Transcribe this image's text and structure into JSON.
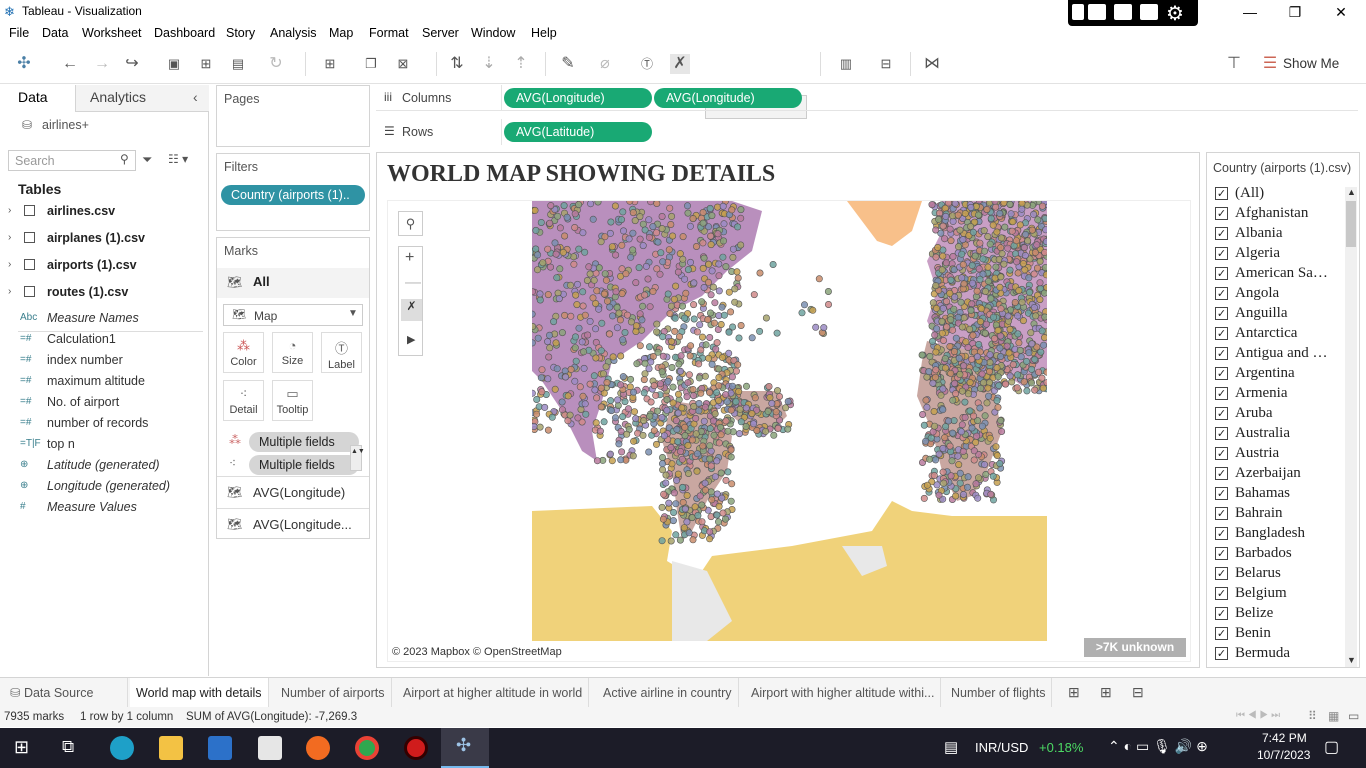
{
  "window": {
    "title": "Tableau - Visualization",
    "min": "—",
    "max": "❐",
    "close": "✕"
  },
  "menu": [
    "File",
    "Data",
    "Worksheet",
    "Dashboard",
    "Story",
    "Analysis",
    "Map",
    "Format",
    "Server",
    "Window",
    "Help"
  ],
  "toolbar": {
    "show_me": "Show Me"
  },
  "data_pane": {
    "tab_data": "Data",
    "tab_analytics": "Analytics",
    "datasource": "airlines+",
    "search_placeholder": "Search",
    "tables_heading": "Tables",
    "tables": [
      "airlines.csv",
      "airplanes (1).csv",
      "airports (1).csv",
      "routes (1).csv"
    ],
    "fields": [
      {
        "icon": "Abc",
        "label": "Measure Names",
        "italic": true
      },
      {
        "icon": "=#",
        "label": "Calculation1",
        "italic": false
      },
      {
        "icon": "=#",
        "label": "index number",
        "italic": false
      },
      {
        "icon": "=#",
        "label": "maximum altitude",
        "italic": false
      },
      {
        "icon": "=#",
        "label": "No. of airport",
        "italic": false
      },
      {
        "icon": "=#",
        "label": "number of records",
        "italic": false
      },
      {
        "icon": "=T|F",
        "label": "top n",
        "italic": false
      },
      {
        "icon": "⊕",
        "label": "Latitude (generated)",
        "italic": true
      },
      {
        "icon": "⊕",
        "label": "Longitude (generated)",
        "italic": true
      },
      {
        "icon": "#",
        "label": "Measure Values",
        "italic": true
      }
    ]
  },
  "shelves": {
    "pages": "Pages",
    "filters": "Filters",
    "filter_pill": "Country (airports (1)..",
    "marks": "Marks",
    "marks_all": "All",
    "mark_type": "Map",
    "mark_buttons": [
      "Color",
      "Size",
      "Label",
      "Detail",
      "Tooltip"
    ],
    "multi1": "Multiple fields",
    "multi2": "Multiple fields",
    "sub1": "AVG(Longitude)",
    "sub2": "AVG(Longitude..."
  },
  "columns": {
    "label": "Columns",
    "pills": [
      "AVG(Longitude)",
      "AVG(Longitude)"
    ]
  },
  "rows": {
    "label": "Rows",
    "pills": [
      "AVG(Latitude)"
    ]
  },
  "viz": {
    "title": "WORLD MAP SHOWING DETAILS",
    "attribution": "© 2023 Mapbox © OpenStreetMap",
    "unknown_badge": ">7K unknown"
  },
  "filter_panel": {
    "title": "Country (airports (1).csv)",
    "items": [
      "(All)",
      "Afghanistan",
      "Albania",
      "Algeria",
      "American Sa…",
      "Angola",
      "Anguilla",
      "Antarctica",
      "Antigua and …",
      "Argentina",
      "Armenia",
      "Aruba",
      "Australia",
      "Austria",
      "Azerbaijan",
      "Bahamas",
      "Bahrain",
      "Bangladesh",
      "Barbados",
      "Belarus",
      "Belgium",
      "Belize",
      "Benin",
      "Bermuda"
    ]
  },
  "sheet_tabs": [
    "Data Source",
    "World map with details",
    "Number of airports",
    "Airport at higher altitude in world",
    "Active airline in country",
    "Airport with higher altitude withi...",
    "Number of flights"
  ],
  "status": {
    "marks": "7935 marks",
    "grid": "1 row by 1 column",
    "sum": "SUM of AVG(Longitude): -7,269.3"
  },
  "taskbar": {
    "ticker": "INR/USD",
    "change": "+0.18%",
    "time": "7:42 PM",
    "date": "10/7/2023"
  },
  "colors": {
    "pill_green": "#19a974",
    "land_yellow": "#f0d27a",
    "land_purple": "#b98fbd"
  }
}
